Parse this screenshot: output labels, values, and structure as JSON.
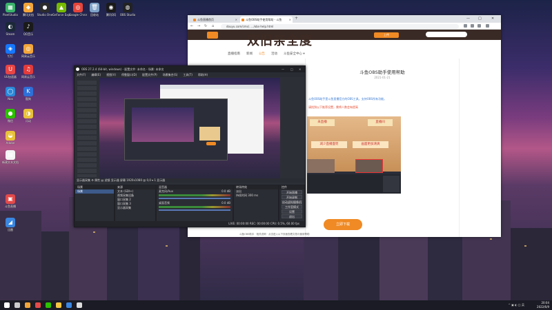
{
  "desktop": {
    "icons": [
      {
        "label": "PixelStudio",
        "color": "#3bb36b",
        "glyph": "▦"
      },
      {
        "label": "腾讯文档",
        "color": "#f3a53a",
        "glyph": "◆"
      },
      {
        "label": "Studio One",
        "color": "#2c2c2c",
        "glyph": "●"
      },
      {
        "label": "GeForce Experience",
        "color": "#76b900",
        "glyph": "▲"
      },
      {
        "label": "Google Chrome",
        "color": "#e6443a",
        "glyph": "◎"
      },
      {
        "label": "回收站",
        "color": "#7fa3c8",
        "glyph": "🗑"
      },
      {
        "label": "腾讯QQ",
        "color": "#1a1a1a",
        "glyph": "◉"
      },
      {
        "label": "OBS Studio",
        "color": "#222",
        "glyph": "◍"
      },
      {
        "label": "Steam",
        "color": "#1b2838",
        "glyph": "◐"
      },
      {
        "label": "QQ音乐",
        "color": "#1a1a1a",
        "glyph": "♪"
      },
      {
        "label": "钉钉",
        "color": "#1677ff",
        "glyph": "◈"
      },
      {
        "label": "网易云音乐",
        "color": "#f3a53a",
        "glyph": "◎"
      },
      {
        "label": "UU加速器",
        "color": "#e84545",
        "glyph": "U"
      },
      {
        "label": "网易云音乐",
        "color": "#e23b3b",
        "glyph": "♫"
      },
      {
        "label": "Nox",
        "color": "#2b88d8",
        "glyph": "◯"
      },
      {
        "label": "酷狗",
        "color": "#2e6fd8",
        "glyph": "K"
      },
      {
        "label": "微信",
        "color": "#2dc100",
        "glyph": "●"
      },
      {
        "label": "闪动",
        "color": "#e8c23a",
        "glyph": "◑"
      },
      {
        "label": "Adobe",
        "color": "#e8c23a",
        "glyph": "◒"
      },
      {
        "label": "新建文本文档",
        "color": "#f4f4f4",
        "glyph": "▤"
      },
      {
        "label": "斗鱼直播",
        "color": "#e24a4a",
        "glyph": "▣"
      },
      {
        "label": "迅雷",
        "color": "#3a86e0",
        "glyph": "◢"
      }
    ]
  },
  "browser": {
    "tabs": [
      {
        "label": "斗鱼直播首页"
      },
      {
        "label": "斗鱼OBS助手使用帮助 - 斗鱼"
      }
    ],
    "new_tab": "+",
    "url": "douyu.com/cms/...../obs-help.html",
    "window_controls": {
      "min": "—",
      "max": "□",
      "close": "✕"
    },
    "banner_title": "双旧亲全度",
    "banner_button": "上传",
    "subnav": [
      "直播指南",
      "新闻",
      "公告",
      "活动",
      "斗鱼安全中心 ▾"
    ],
    "subnav_active_index": 2,
    "article_title": "斗鱼OBS助手使用帮助",
    "article_date": "2021-01-21",
    "article_intro": "斗鱼OBS助手是斗鱼直播官方的OBS工具，支持OBS所有功能。",
    "article_highlight": "请找到以下推荐设置，需将人数会有提高",
    "shot_labels": {
      "left": "未直播",
      "right": "直播间",
      "mid1": "减少直播面罚",
      "mid2": "画面更加清爽"
    },
    "download_button": "立即下载",
    "footer_text": "斗鱼OBS助手 · 相关说明 · 点击进入以下页面查看文档与使用帮助"
  },
  "obs": {
    "title": "OBS 27.2.4 (64-bit, windows) - 配置文件: 未命名 - 场景: 未命名",
    "menu": [
      "文件(F)",
      "编辑(E)",
      "视图(V)",
      "停靠窗口(D)",
      "配置文件(P)",
      "场景集合(S)",
      "工具(T)",
      "帮助(H)"
    ],
    "window_controls": {
      "min": "—",
      "max": "□",
      "close": "✕"
    },
    "toolbar": "显示器采集    ⚙ 属性    ▤ 滤镜    显示器  屏幕  1920x1080 @ 0,0    ▾ 1 显示器",
    "docks": {
      "scenes": {
        "title": "场景",
        "items": [
          "场景"
        ]
      },
      "sources": {
        "title": "来源",
        "items": [
          "文本 (GDI+)",
          "视频采集设备",
          "窗口采集 2",
          "窗口采集 3",
          "显示器采集"
        ]
      },
      "mixer": {
        "title": "混音器",
        "channels": [
          {
            "name": "麦克风/Aux",
            "db": "0.0 dB"
          },
          {
            "name": "桌面音频",
            "db": "0.0 dB"
          }
        ]
      },
      "transitions": {
        "title": "转场特效",
        "items": [
          "淡出",
          "持续时间  300 ms"
        ]
      },
      "controls": {
        "title": "控件",
        "buttons": [
          "开始直播",
          "开始录制",
          "启动虚拟摄像机",
          "工作室模式",
          "设置",
          "退出"
        ]
      }
    },
    "status": "LIVE: 00:00:00    REC: 00:00:00    CPU: 0.5%, 60.00 fps"
  },
  "taskbar": {
    "pinned": [
      {
        "name": "windows-start-icon",
        "color": "#ffffff"
      },
      {
        "name": "search-icon",
        "color": "#cccccc"
      },
      {
        "name": "chrome-icon",
        "color": "#f3a53a"
      },
      {
        "name": "douyu-icon",
        "color": "#e24a4a"
      },
      {
        "name": "wechat-icon",
        "color": "#2dc100"
      },
      {
        "name": "explorer-icon",
        "color": "#f4c542"
      },
      {
        "name": "store-icon",
        "color": "#3a86e0"
      },
      {
        "name": "obs-icon",
        "color": "#dddddd"
      }
    ],
    "tray": "^ ▣ ◐ ◫ 英",
    "time": "20:04",
    "date": "2022/6/9"
  }
}
